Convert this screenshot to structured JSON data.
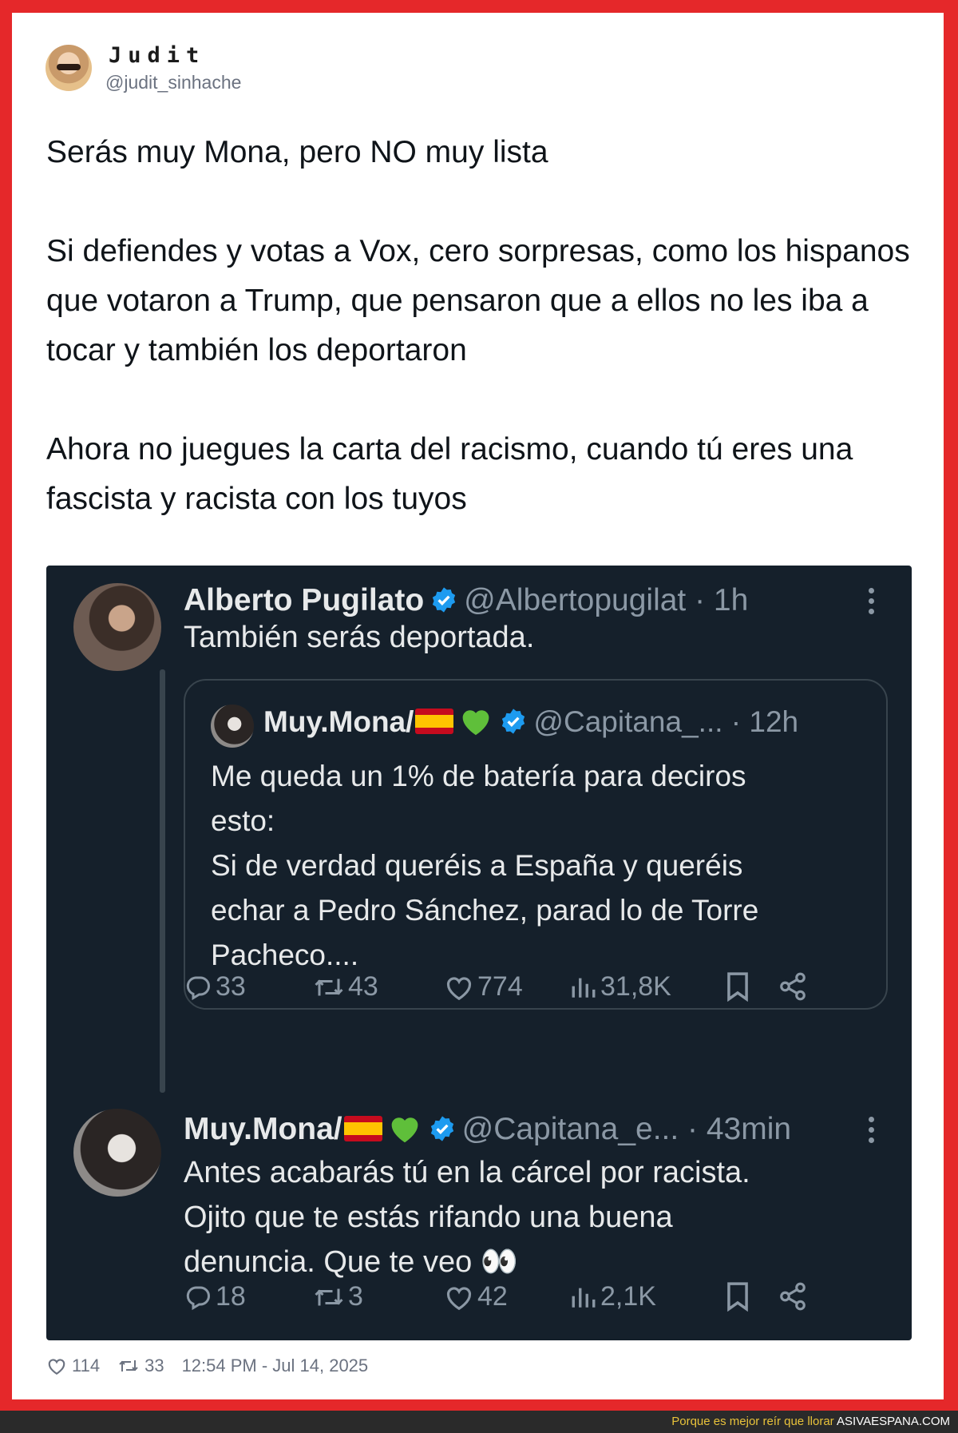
{
  "post": {
    "author_name": "Judit",
    "author_handle": "@judit_sinhache",
    "paragraphs": [
      "Serás muy Mona, pero NO muy lista",
      "Si defiendes y votas a Vox, cero sorpresas, como los hispanos que votaron a Trump, que pensaron que a ellos no les iba a tocar y también los deportaron",
      "Ahora no juegues la carta del racismo, cuando tú eres una fascista y racista con los tuyos"
    ],
    "likes": "114",
    "retweets": "33",
    "timestamp": "12:54 PM - Jul 14, 2025"
  },
  "screenshot": {
    "reply1": {
      "name": "Alberto Pugilato",
      "handle_time": "@Albertopugilat · 1h",
      "text": "También serás deportada.",
      "quote": {
        "name": "Muy.Mona/",
        "handle_time": "@Capitana_... · 12h",
        "lines": [
          "Me queda un 1% de batería para deciros",
          "esto:",
          "Si de verdad queréis a España y queréis",
          "echar a Pedro Sánchez, parad lo de Torre",
          "Pacheco...."
        ]
      },
      "stats": {
        "replies": "33",
        "retweets": "43",
        "likes": "774",
        "views": "31,8K"
      }
    },
    "reply2": {
      "name": "Muy.Mona/",
      "handle_time": "@Capitana_e... · 43min",
      "lines": [
        "Antes acabarás tú en la cárcel por racista.",
        "Ojito que te estás rifando una buena",
        "denuncia. Que te veo 👀"
      ],
      "stats": {
        "replies": "18",
        "retweets": "3",
        "likes": "42",
        "views": "2,1K"
      }
    }
  },
  "footer": {
    "tagline": "Porque es mejor reír que llorar",
    "site": "ASIVAESPANA.COM"
  },
  "colors": {
    "frame": "#e5282a",
    "dark_bg": "#15202b",
    "verified": "#1d9bf0",
    "muted": "#8b98a5"
  }
}
